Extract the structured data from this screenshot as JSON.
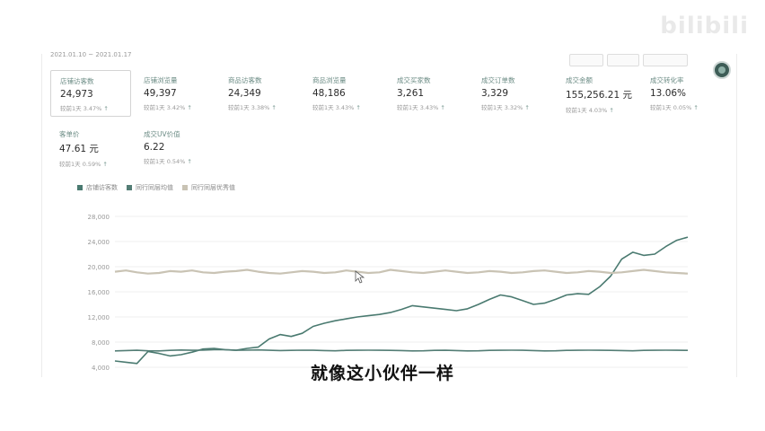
{
  "watermark": "bilibili",
  "topbar": {
    "date_text": "2021.01.10 ~ 2021.01.17"
  },
  "colors": {
    "visitors": "#4a7a70",
    "peer_avg": "#537d75",
    "peer_excellent": "#c9c3b4"
  },
  "metrics": [
    {
      "label": "店铺访客数",
      "value": "24,973",
      "compare": "较前1天 3.47%",
      "selected": true
    },
    {
      "label": "店铺浏览量",
      "value": "49,397",
      "compare": "较前1天 3.42%"
    },
    {
      "label": "商品访客数",
      "value": "24,349",
      "compare": "较前1天 3.38%"
    },
    {
      "label": "商品浏览量",
      "value": "48,186",
      "compare": "较前1天 3.43%"
    },
    {
      "label": "成交买家数",
      "value": "3,261",
      "compare": "较前1天 3.43%"
    },
    {
      "label": "成交订单数",
      "value": "3,329",
      "compare": "较前1天 3.32%"
    },
    {
      "label": "成交金额",
      "value": "155,256.21 元",
      "compare": "较前1天 4.03%"
    },
    {
      "label": "成交转化率",
      "value": "13.06%",
      "compare": "较前1天 0.05%"
    },
    {
      "label": "客单价",
      "value": "47.61 元",
      "compare": "较前1天 0.59%"
    },
    {
      "label": "成交UV价值",
      "value": "6.22",
      "compare": "较前1天 0.54%"
    }
  ],
  "legend": [
    "店铺访客数",
    "同行同层均值",
    "同行同层优秀值"
  ],
  "chart_data": {
    "type": "line",
    "yticks": [
      "28,000",
      "24,000",
      "20,000",
      "16,000",
      "12,000",
      "8,000",
      "4,000"
    ],
    "ylim": [
      4000,
      28000
    ],
    "grid": true,
    "series": [
      {
        "name": "店铺访客数",
        "values": [
          5000,
          4800,
          4600,
          6500,
          6200,
          5800,
          6000,
          6400,
          6900,
          7000,
          6800,
          6700,
          7000,
          7200,
          8500,
          9200,
          8900,
          9400,
          10500,
          11000,
          11400,
          11700,
          12000,
          12200,
          12400,
          12700,
          13200,
          13800,
          13600,
          13400,
          13200,
          13000,
          13300,
          14000,
          14800,
          15500,
          15200,
          14600,
          14000,
          14200,
          14800,
          15500,
          15700,
          15600,
          16800,
          18500,
          21200,
          22300,
          21800,
          22000,
          23200,
          24200,
          24700
        ]
      },
      {
        "name": "同行同层均值",
        "values": [
          6600,
          6650,
          6700,
          6620,
          6600,
          6680,
          6750,
          6700,
          6720,
          6800,
          6780,
          6700,
          6720,
          6760,
          6700,
          6650,
          6680,
          6720,
          6700,
          6650,
          6620,
          6680,
          6700,
          6720,
          6700,
          6680,
          6650,
          6600,
          6620,
          6680,
          6700,
          6650,
          6600,
          6620,
          6680,
          6700,
          6720,
          6700,
          6650,
          6600,
          6620,
          6680,
          6700,
          6720,
          6700,
          6680,
          6650,
          6620,
          6680,
          6700,
          6720,
          6700,
          6680
        ]
      },
      {
        "name": "同行同层优秀值",
        "values": [
          19200,
          19400,
          19100,
          18900,
          19000,
          19300,
          19200,
          19400,
          19100,
          19000,
          19200,
          19300,
          19500,
          19200,
          19000,
          18900,
          19100,
          19300,
          19200,
          19000,
          19100,
          19400,
          19200,
          19000,
          19100,
          19500,
          19300,
          19100,
          19000,
          19200,
          19400,
          19200,
          19000,
          19100,
          19300,
          19200,
          19000,
          19100,
          19300,
          19400,
          19200,
          19000,
          19100,
          19300,
          19200,
          19000,
          19100,
          19300,
          19500,
          19300,
          19100,
          19000,
          18900
        ]
      }
    ]
  },
  "subtitle": "就像这小伙伴一样"
}
